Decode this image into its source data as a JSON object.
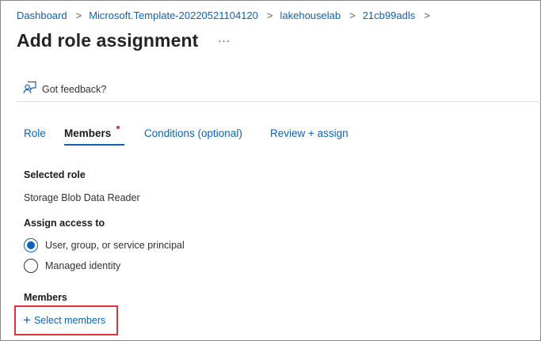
{
  "breadcrumb": {
    "items": [
      "Dashboard",
      "Microsoft.Template-20220521104120",
      "lakehouselab",
      "21cb99adls"
    ],
    "separator": ">"
  },
  "header": {
    "title": "Add role assignment",
    "more_label": "..."
  },
  "feedback": {
    "icon": "feedback-person-icon",
    "label": "Got feedback?"
  },
  "tabs": [
    {
      "label": "Role",
      "active": false
    },
    {
      "label": "Members",
      "active": true,
      "has_indicator": true
    },
    {
      "label": "Conditions (optional)",
      "active": false
    },
    {
      "label": "Review + assign",
      "active": false
    }
  ],
  "selected_role": {
    "heading": "Selected role",
    "value": "Storage Blob Data Reader"
  },
  "assign_access": {
    "heading": "Assign access to",
    "options": [
      {
        "label": "User, group, or service principal",
        "checked": true
      },
      {
        "label": "Managed identity",
        "checked": false
      }
    ]
  },
  "members": {
    "heading": "Members",
    "select_label": "Select members",
    "select_icon": "plus-icon"
  },
  "colors": {
    "link": "#0f62b6",
    "highlight_border": "#e3323b",
    "indicator": "#d13438"
  }
}
